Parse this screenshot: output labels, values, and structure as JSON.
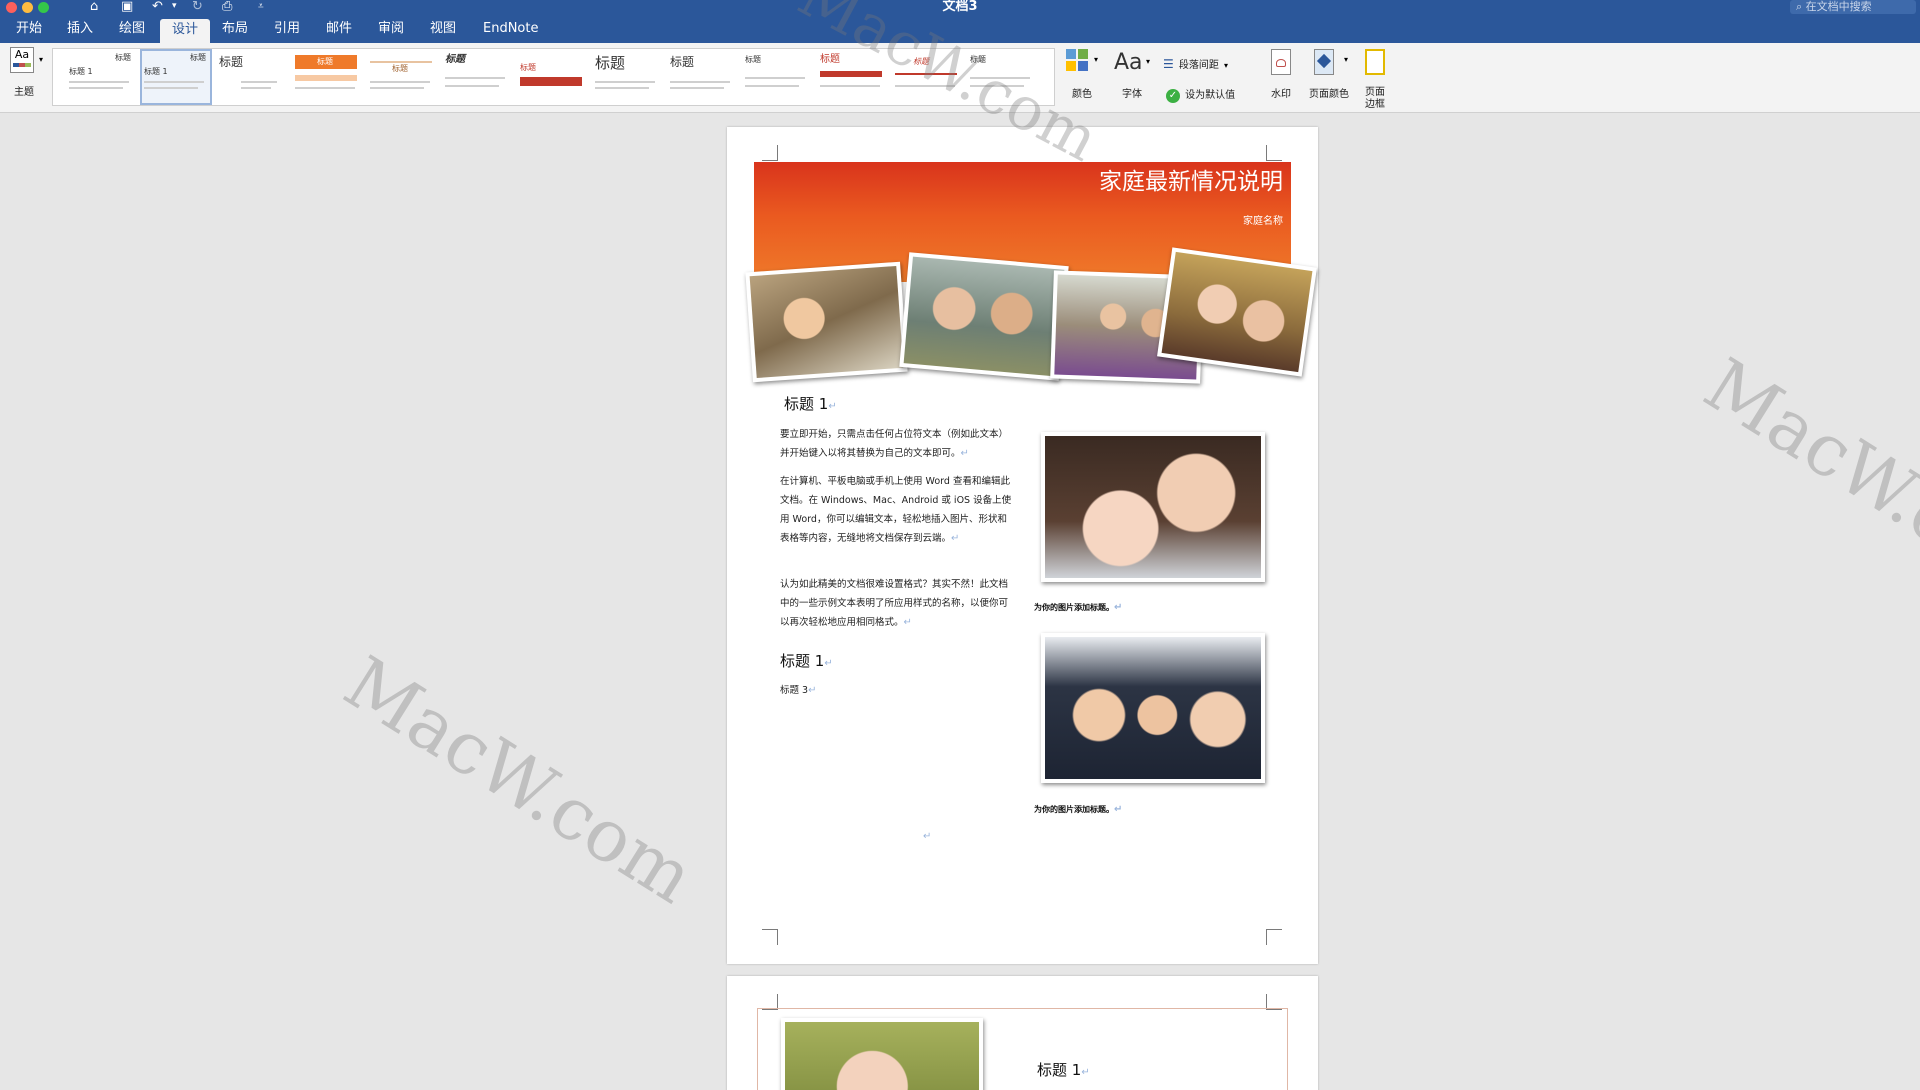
{
  "window": {
    "title": "文档3",
    "search_placeholder": "在文档中搜索"
  },
  "tabs": [
    {
      "label": "开始"
    },
    {
      "label": "插入"
    },
    {
      "label": "绘图"
    },
    {
      "label": "设计",
      "active": true
    },
    {
      "label": "布局"
    },
    {
      "label": "引用"
    },
    {
      "label": "邮件"
    },
    {
      "label": "审阅"
    },
    {
      "label": "视图"
    },
    {
      "label": "EndNote"
    }
  ],
  "ribbon": {
    "theme_label": "主题",
    "theme_icon_text": "Aa",
    "gallery": {
      "thumb_titles": [
        "标题",
        "标题",
        "标题",
        "标题",
        "标题",
        "标题",
        "标题",
        "标题",
        "标题",
        "标题",
        "标题",
        "标题",
        "标题"
      ],
      "thumb_subtitle": "标题 1"
    },
    "colors_label": "颜色",
    "fonts_label": "字体",
    "fonts_icon_text": "Aa",
    "paragraph_spacing_label": "段落间距",
    "set_default_label": "设为默认值",
    "watermark_label": "水印",
    "page_color_label": "页面颜色",
    "page_borders_label": "页面\n边框"
  },
  "document": {
    "banner_title": "家庭最新情况说明",
    "banner_subtitle": "家庭名称",
    "heading1": "标题 1",
    "para1": "要立即开始，只需点击任何占位符文本（例如此文本）并开始键入以将其替换为自己的文本即可。",
    "para2": "在计算机、平板电脑或手机上使用 Word 查看和编辑此文档。在 Windows、Mac、Android 或 iOS 设备上使用 Word，你可以编辑文本，轻松地插入图片、形状和表格等内容，无缝地将文档保存到云端。",
    "para3": "认为如此精美的文档很难设置格式？其实不然！此文档中的一些示例文本表明了所应用样式的名称，以便你可以再次轻松地应用相同格式。",
    "heading1_b": "标题 1",
    "heading3": "标题 3",
    "caption1": "为你的图片添加标题。",
    "caption2": "为你的图片添加标题。",
    "page2_heading": "标题 1",
    "paragraph_mark": "↵"
  },
  "watermark_text": "MacW.com",
  "colors": {
    "accent": "#2b579a",
    "banner_top": "#d9341c",
    "banner_bottom": "#ef7a2a"
  }
}
